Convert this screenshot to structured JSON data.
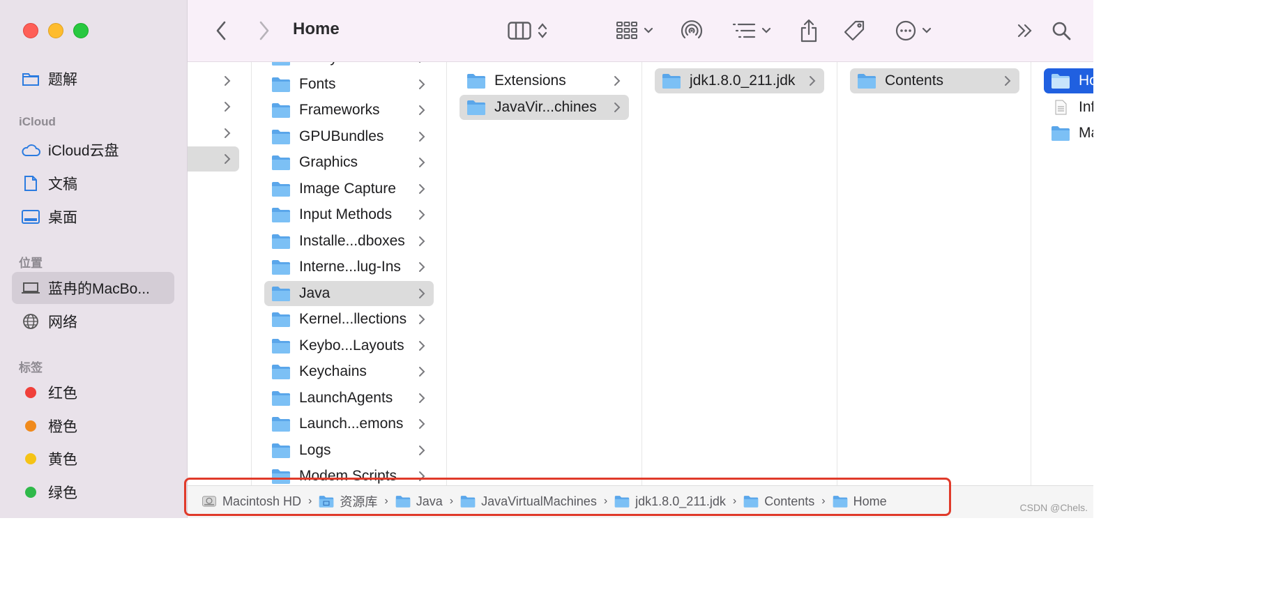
{
  "window": {
    "title": "Home"
  },
  "sidebar": {
    "favorites": [
      {
        "label": "题解",
        "icon": "folder-icon"
      }
    ],
    "icloud_heading": "iCloud",
    "icloud": [
      {
        "label": "iCloud云盘",
        "icon": "cloud-icon"
      },
      {
        "label": "文稿",
        "icon": "document-icon"
      },
      {
        "label": "桌面",
        "icon": "desktop-icon"
      }
    ],
    "locations_heading": "位置",
    "locations": [
      {
        "label": "蓝冉的MacBo...",
        "icon": "laptop-icon",
        "selected": true
      },
      {
        "label": "网络",
        "icon": "globe-icon"
      }
    ],
    "tags_heading": "标签",
    "tags": [
      {
        "label": "红色",
        "color": "#f0403a"
      },
      {
        "label": "橙色",
        "color": "#f08a1c"
      },
      {
        "label": "黄色",
        "color": "#f5c316"
      },
      {
        "label": "绿色",
        "color": "#2fb94a"
      }
    ]
  },
  "columns": {
    "library": [
      {
        "label": "Filesystems"
      },
      {
        "label": "Fonts"
      },
      {
        "label": "Frameworks"
      },
      {
        "label": "GPUBundles"
      },
      {
        "label": "Graphics"
      },
      {
        "label": "Image Capture"
      },
      {
        "label": "Input Methods"
      },
      {
        "label": "Installe...dboxes"
      },
      {
        "label": "Interne...lug-Ins"
      },
      {
        "label": "Java",
        "selected": true
      },
      {
        "label": "Kernel...llections"
      },
      {
        "label": "Keybo...Layouts"
      },
      {
        "label": "Keychains"
      },
      {
        "label": "LaunchAgents"
      },
      {
        "label": "Launch...emons"
      },
      {
        "label": "Logs"
      },
      {
        "label": "Modem Scripts"
      }
    ],
    "java": [
      {
        "label": "Extensions"
      },
      {
        "label": "JavaVir...chines",
        "selected": true
      }
    ],
    "jvm": [
      {
        "label": "jdk1.8.0_211.jdk",
        "selected": true
      }
    ],
    "jdk": [
      {
        "label": "Contents",
        "selected": true
      }
    ],
    "contents": [
      {
        "label": "Ho",
        "type": "folder",
        "active": true
      },
      {
        "label": "Inf",
        "type": "file"
      },
      {
        "label": "Ma",
        "type": "folder"
      }
    ]
  },
  "pathbar": {
    "crumbs": [
      {
        "label": "Macintosh HD",
        "icon": "hard-drive-icon"
      },
      {
        "label": "资源库",
        "icon": "library-folder-icon"
      },
      {
        "label": "Java",
        "icon": "folder-icon"
      },
      {
        "label": "JavaVirtualMachines",
        "icon": "folder-icon"
      },
      {
        "label": "jdk1.8.0_211.jdk",
        "icon": "folder-icon"
      },
      {
        "label": "Contents",
        "icon": "folder-icon"
      },
      {
        "label": "Home",
        "icon": "folder-icon"
      }
    ]
  },
  "watermark": "CSDN @Chels.",
  "colors": {
    "folder": "#68b3f0",
    "selection_active": "#2060e0",
    "highlight_box": "#e03a2a"
  }
}
